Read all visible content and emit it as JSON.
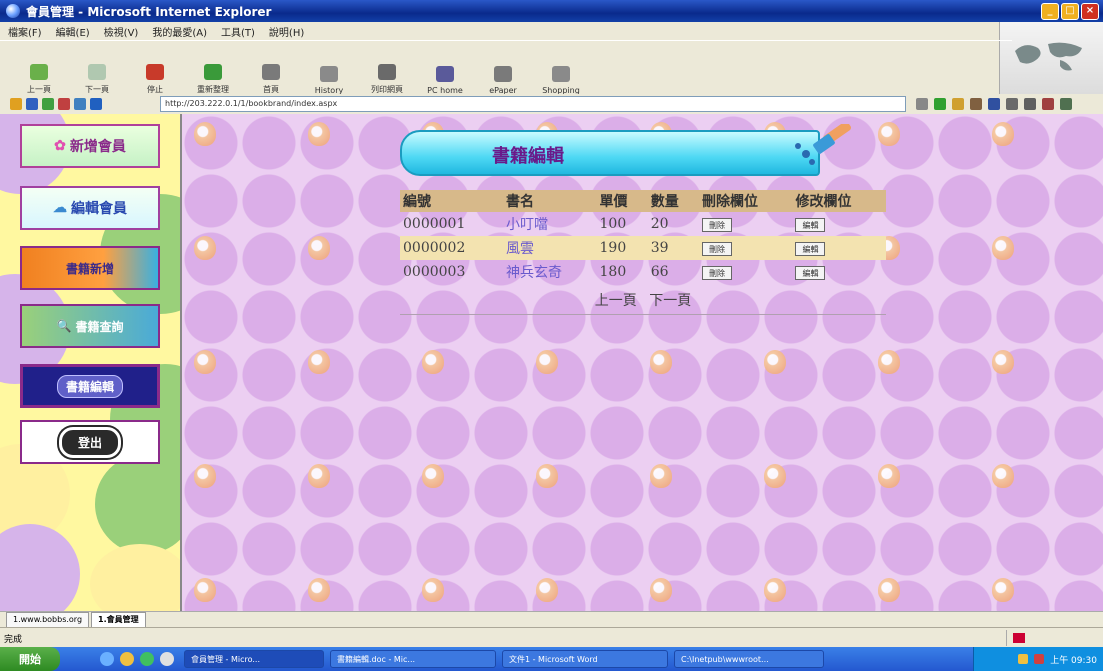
{
  "window": {
    "title": "會員管理 - Microsoft Internet Explorer"
  },
  "menu": [
    "檔案(F)",
    "編輯(E)",
    "檢視(V)",
    "我的最愛(A)",
    "工具(T)",
    "說明(H)"
  ],
  "toolbar": [
    {
      "label": "上一頁",
      "icon": "back-icon"
    },
    {
      "label": "下一頁",
      "icon": "forward-icon"
    },
    {
      "label": "停止",
      "icon": "stop-icon"
    },
    {
      "label": "重新整理",
      "icon": "refresh-icon"
    },
    {
      "label": "首頁",
      "icon": "home-icon"
    },
    {
      "label": "History",
      "icon": "history-icon"
    },
    {
      "label": "列印網頁",
      "icon": "print-icon"
    },
    {
      "label": "PC home",
      "icon": "pchome-icon"
    },
    {
      "label": "ePaper",
      "icon": "epaper-icon"
    },
    {
      "label": "Shopping",
      "icon": "shopping-icon"
    }
  ],
  "address": {
    "url": "http://203.222.0.1/1/bookbrand/index.aspx"
  },
  "sidebar": {
    "items": [
      {
        "label": "新增會員"
      },
      {
        "label": "編輯會員"
      },
      {
        "label": "書籍新增"
      },
      {
        "label": "書籍查詢"
      },
      {
        "label": "書籍編輯"
      },
      {
        "label": "登出"
      }
    ]
  },
  "main": {
    "title": "書籍編輯",
    "table": {
      "headers": [
        "編號",
        "書名",
        "單價",
        "數量",
        "刪除欄位",
        "修改欄位"
      ],
      "rows": [
        {
          "id": "0000001",
          "name": "小叮噹",
          "price": "100",
          "qty": "20",
          "delete": "刪除",
          "edit": "編輯"
        },
        {
          "id": "0000002",
          "name": "風雲",
          "price": "190",
          "qty": "39",
          "delete": "刪除",
          "edit": "編輯"
        },
        {
          "id": "0000003",
          "name": "神兵玄奇",
          "price": "180",
          "qty": "66",
          "delete": "刪除",
          "edit": "編輯"
        }
      ]
    },
    "pager": {
      "prev": "上一頁",
      "next": "下一頁"
    }
  },
  "frametabs": [
    "1.www.bobbs.org",
    "1.會員管理"
  ],
  "status": {
    "text": "完成"
  },
  "taskbar": {
    "start": "開始",
    "tasks": [
      "會員管理 - Micro...",
      "書籍編輯.doc - Mic...",
      "文件1 - Microsoft Word",
      "C:\\Inetpub\\wwwroot..."
    ],
    "clock": "上午 09:30"
  },
  "colors": {
    "accent": "#2458d0",
    "banner": "#4ed8f4",
    "background": "#eccff2"
  }
}
